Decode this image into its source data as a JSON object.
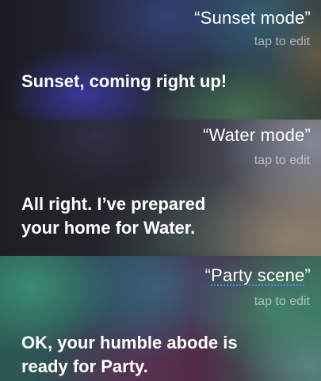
{
  "conversation": [
    {
      "user_quote": "“Sunset mode”",
      "edit_label": "tap to edit",
      "reply_lines": [
        "Sunset, coming right up!"
      ]
    },
    {
      "user_quote": "“Water mode”",
      "edit_label": "tap to edit",
      "reply_lines": [
        "All right. I’ve prepared",
        "your home for Water."
      ]
    },
    {
      "user_quote_open": "“",
      "user_quote_word": "Party scene",
      "user_quote_close": "”",
      "edit_label": "tap to edit",
      "reply_lines": [
        "OK, your humble abode is",
        "ready for Party."
      ]
    }
  ],
  "colors": {
    "text_primary": "#ffffff",
    "text_secondary": "rgba(255,255,255,0.55)",
    "dictation_underline": "#4a8cff"
  }
}
